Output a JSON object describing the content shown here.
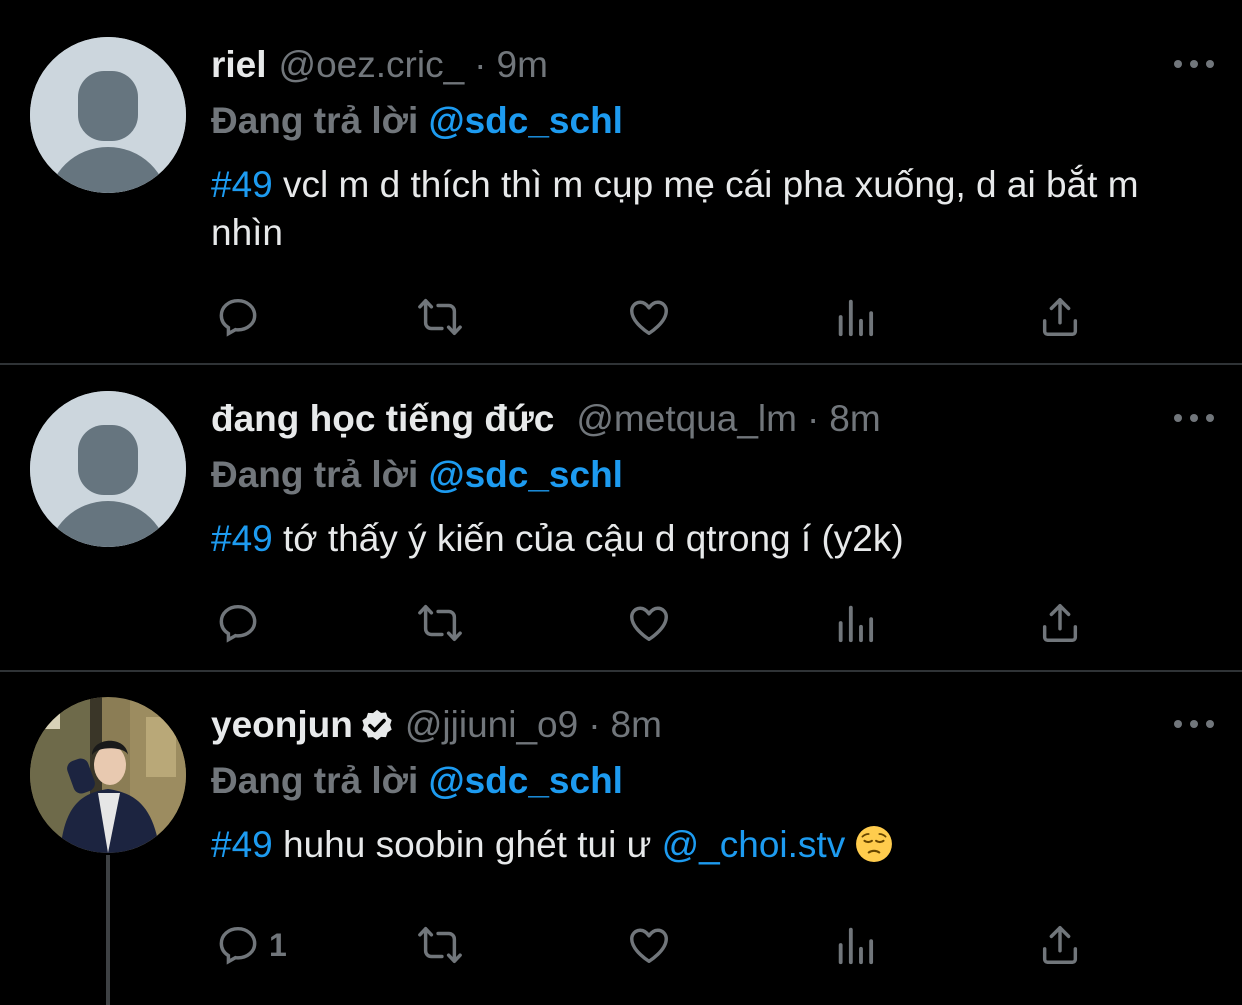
{
  "tweets": [
    {
      "name": "riel",
      "handle": "@oez.cric_",
      "time": "9m",
      "replying_prefix": "Đang trả lời",
      "replying_to": "@sdc_schl",
      "tag": "#49",
      "text": "vcl m d thích thì m cụp mẹ cái pha xuống, d ai bắt m nhìn",
      "avatar": "default-avatar",
      "reply_count": ""
    },
    {
      "name": "đang học tiếng đức",
      "handle": "@metqua_lm",
      "time": "8m",
      "replying_prefix": "Đang trả lời",
      "replying_to": "@sdc_schl",
      "tag": "#49",
      "text": "tớ thấy ý kiến của cậu d qtrong í (y2k)",
      "avatar": "default-avatar",
      "reply_count": ""
    },
    {
      "name": "yeonjun",
      "handle": "@jjiuni_o9",
      "time": "8m",
      "replying_prefix": "Đang trả lời",
      "replying_to": "@sdc_schl",
      "tag": "#49",
      "text": "huhu soobin ghét tui ư",
      "mention": "@_choi.stv",
      "emoji": "pensive-face",
      "avatar": "photo-avatar",
      "verified": true,
      "reply_count": "1"
    }
  ],
  "icons": [
    "reply-icon",
    "retweet-icon",
    "like-icon",
    "analytics-icon",
    "share-icon",
    "more-icon"
  ],
  "colors": {
    "background": "#000000",
    "accent": "#1d9bf0",
    "muted": "#71767b",
    "text": "#e7e9ea"
  }
}
